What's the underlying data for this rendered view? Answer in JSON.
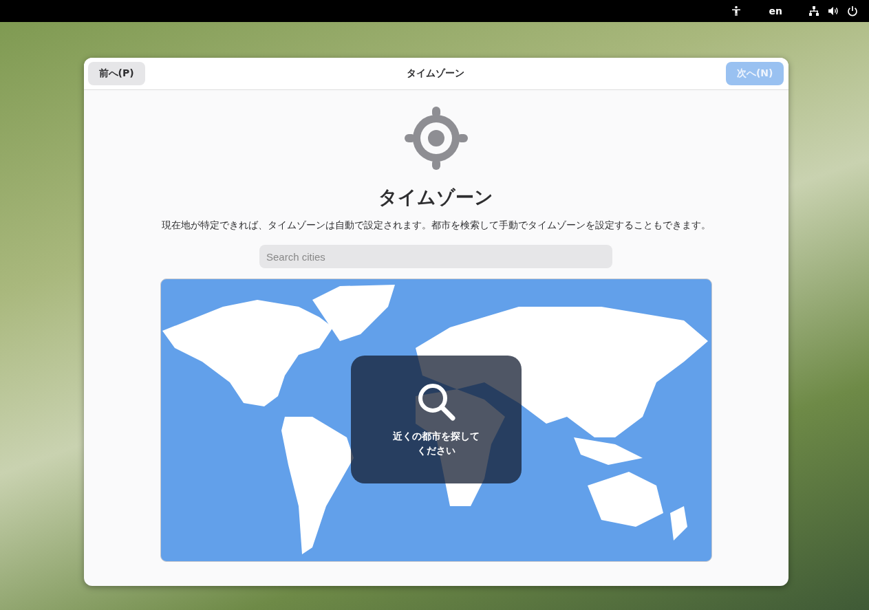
{
  "top_bar": {
    "language": "en"
  },
  "dialog": {
    "title": "タイムゾーン",
    "back_button": {
      "label": "前へ(P)",
      "disabled": false
    },
    "next_button": {
      "label": "次へ(N)",
      "disabled": true
    },
    "heading": "タイムゾーン",
    "description": "現在地が特定できれば、タイムゾーンは自動で設定されます。都市を検索して手動でタイムゾーンを設定することもできます。",
    "search": {
      "placeholder": "Search cities"
    },
    "map_hint": "近くの都市を探してください"
  }
}
